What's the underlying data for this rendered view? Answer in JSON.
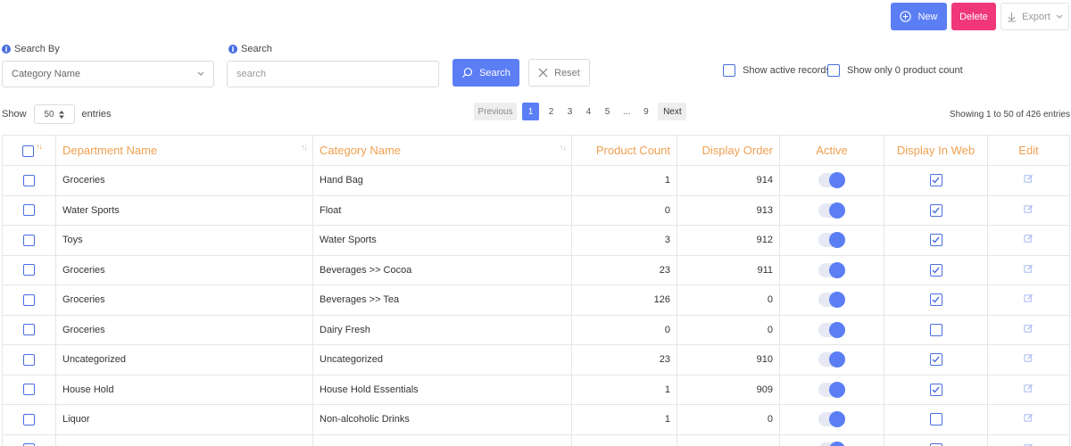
{
  "toolbar": {
    "new_label": "New",
    "delete_label": "Delete",
    "export_label": "Export",
    "accent": "#5b7ef5",
    "delete_color": "#f0377a"
  },
  "filters": {
    "search_by_label": "Search By",
    "search_by_value": "Category Name",
    "search_label": "Search",
    "search_placeholder": "search",
    "search_button": "Search",
    "reset_button": "Reset",
    "show_active_label": "Show active records",
    "show_zero_label": "Show only 0 product count"
  },
  "entries": {
    "show_label": "Show",
    "page_size": "50",
    "entries_label": "entries",
    "info": "Showing 1 to 50 of 426 entries"
  },
  "pagination": {
    "previous": "Previous",
    "pages": [
      "1",
      "2",
      "3",
      "4",
      "5",
      "...",
      "9"
    ],
    "current": "1",
    "next": "Next"
  },
  "table": {
    "header_color": "#f0a050",
    "columns": {
      "department": "Department Name",
      "category": "Category Name",
      "product_count": "Product Count",
      "display_order": "Display Order",
      "active": "Active",
      "display_web": "Display In Web",
      "edit": "Edit"
    },
    "rows": [
      {
        "department": "Groceries",
        "category": "Hand Bag",
        "product_count": "1",
        "display_order": "914",
        "active": true,
        "display_web": true
      },
      {
        "department": "Water Sports",
        "category": "Float",
        "product_count": "0",
        "display_order": "913",
        "active": true,
        "display_web": true
      },
      {
        "department": "Toys",
        "category": "Water Sports",
        "product_count": "3",
        "display_order": "912",
        "active": true,
        "display_web": true
      },
      {
        "department": "Groceries",
        "category": "Beverages >> Cocoa",
        "product_count": "23",
        "display_order": "911",
        "active": true,
        "display_web": true
      },
      {
        "department": "Groceries",
        "category": "Beverages >> Tea",
        "product_count": "126",
        "display_order": "0",
        "active": true,
        "display_web": true
      },
      {
        "department": "Groceries",
        "category": "Dairy Fresh",
        "product_count": "0",
        "display_order": "0",
        "active": true,
        "display_web": false
      },
      {
        "department": "Uncategorized",
        "category": "Uncategorized",
        "product_count": "23",
        "display_order": "910",
        "active": true,
        "display_web": true
      },
      {
        "department": "House Hold",
        "category": "House Hold Essentials",
        "product_count": "1",
        "display_order": "909",
        "active": true,
        "display_web": true
      },
      {
        "department": "Liquor",
        "category": "Non-alcoholic Drinks",
        "product_count": "1",
        "display_order": "0",
        "active": true,
        "display_web": false
      },
      {
        "department": "",
        "category": "",
        "product_count": "",
        "display_order": "",
        "active": true,
        "display_web": false
      }
    ]
  }
}
